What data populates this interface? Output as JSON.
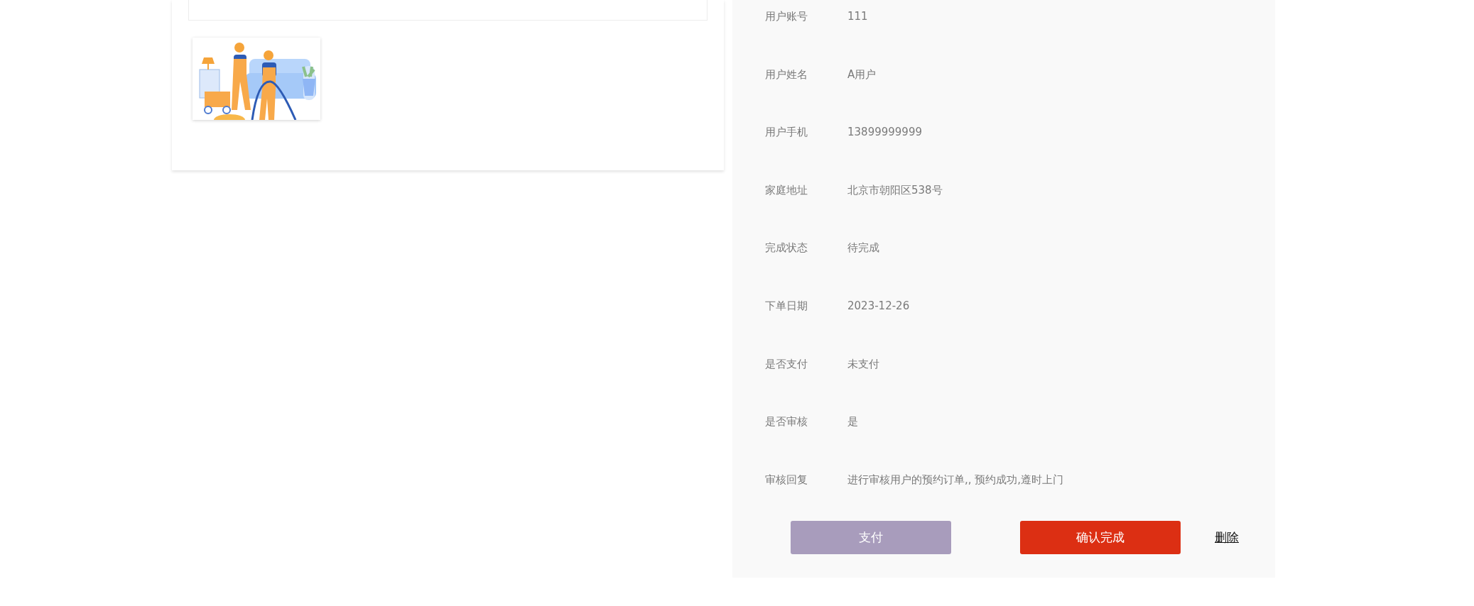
{
  "fields": [
    {
      "label": "用户账号",
      "value": "111"
    },
    {
      "label": "用户姓名",
      "value": "A用户"
    },
    {
      "label": "用户手机",
      "value": "13899999999"
    },
    {
      "label": "家庭地址",
      "value": "北京市朝阳区538号"
    },
    {
      "label": "完成状态",
      "value": "待完成"
    },
    {
      "label": "下单日期",
      "value": "2023-12-26"
    },
    {
      "label": "是否支付",
      "value": "未支付"
    },
    {
      "label": "是否审核",
      "value": "是"
    },
    {
      "label": "审核回复",
      "value": "进行审核用户的预约订单,, 预约成功,遵时上门"
    }
  ],
  "actions": [
    {
      "kind": "muted",
      "label": "支付"
    },
    {
      "kind": "danger",
      "label": "确认完成"
    },
    {
      "kind": "link",
      "label": "删除"
    }
  ]
}
